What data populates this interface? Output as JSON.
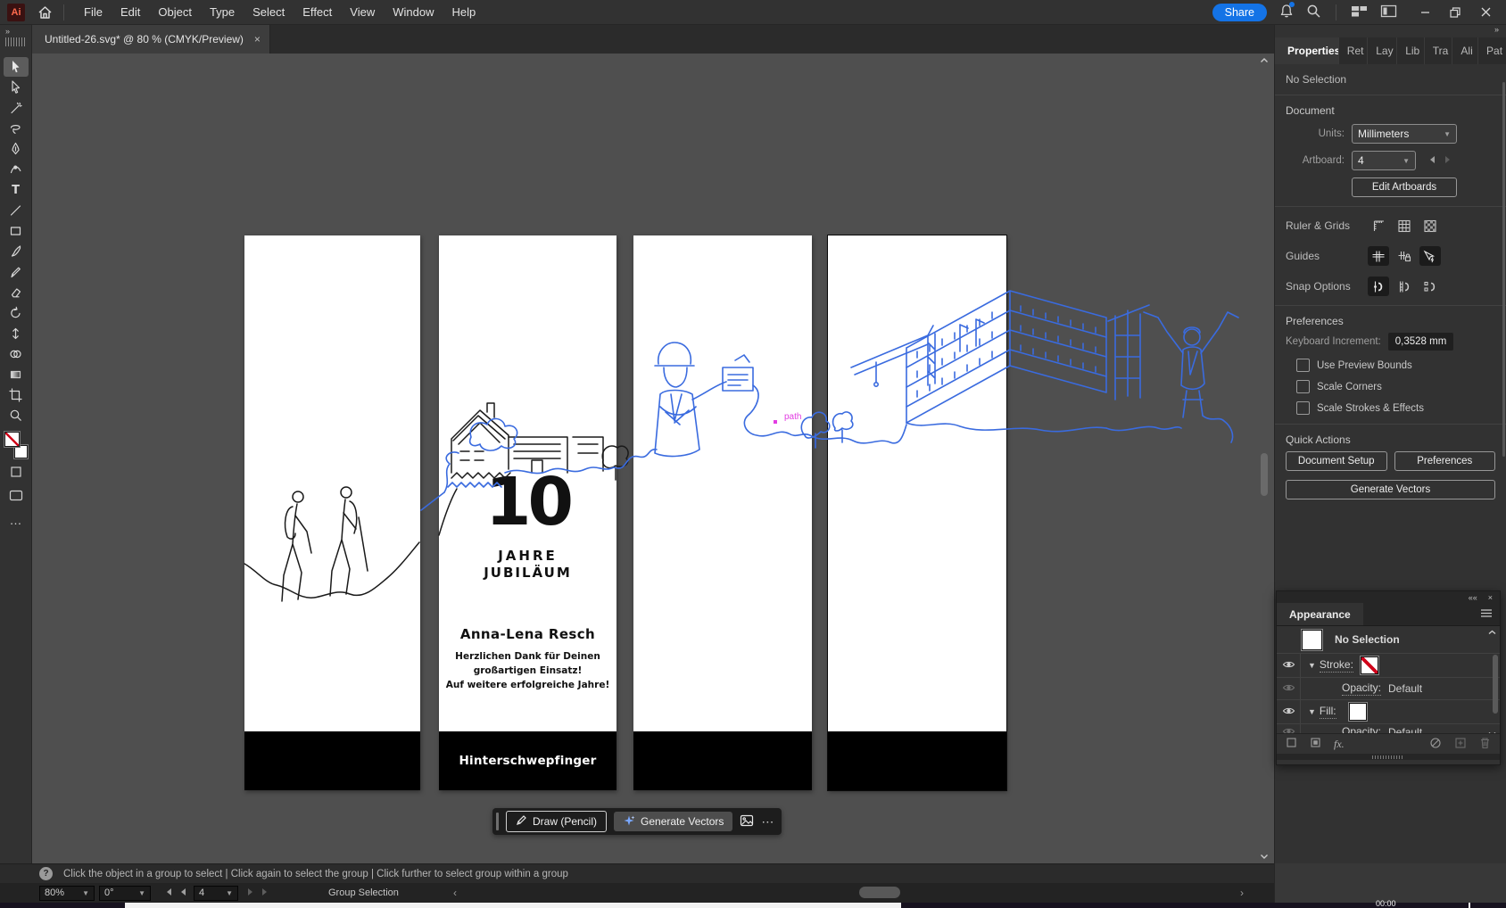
{
  "window": {
    "app_badge": "Ai",
    "share": "Share",
    "timer": "00:00"
  },
  "menubar": {
    "items": [
      "File",
      "Edit",
      "Object",
      "Type",
      "Select",
      "Effect",
      "View",
      "Window",
      "Help"
    ]
  },
  "tab": {
    "title": "Untitled-26.svg* @ 80 % (CMYK/Preview)",
    "close": "×"
  },
  "panel": {
    "tabs": [
      "Properties",
      "Ret",
      "Lay",
      "Lib",
      "Tra",
      "Ali",
      "Pat"
    ],
    "no_selection": "No Selection",
    "document": {
      "title": "Document",
      "units_label": "Units:",
      "units_value": "Millimeters",
      "artboard_label": "Artboard:",
      "artboard_value": "4",
      "edit_artboards": "Edit Artboards"
    },
    "ruler_grids": "Ruler & Grids",
    "guides": "Guides",
    "snap_options": "Snap Options",
    "prefs": {
      "title": "Preferences",
      "keyboard_increment_label": "Keyboard Increment:",
      "keyboard_increment_value": "0,3528 mm",
      "checks": [
        "Use Preview Bounds",
        "Scale Corners",
        "Scale Strokes & Effects"
      ]
    },
    "quick_actions": {
      "title": "Quick Actions",
      "document_setup": "Document Setup",
      "preferences": "Preferences",
      "generate_vectors": "Generate Vectors"
    }
  },
  "appearance": {
    "title": "Appearance",
    "no_selection": "No Selection",
    "stroke_label": "Stroke:",
    "fill_label": "Fill:",
    "opacity_label": "Opacity:",
    "opacity_value": "Default",
    "fx": "fx."
  },
  "artboard2": {
    "big_number": "10",
    "jahre": "JAHRE",
    "jubilaeum": "JUBILÄUM",
    "name": "Anna-Lena Resch",
    "msg1": "Herzlichen Dank für Deinen",
    "msg2": "großartigen Einsatz!",
    "msg3": "Auf weitere erfolgreiche Jahre!",
    "footer": "Hinterschwepfinger"
  },
  "canvas": {
    "path_label": "path"
  },
  "float_toolbar": {
    "draw": "Draw (Pencil)",
    "generate": "Generate Vectors"
  },
  "hint": {
    "icon": "?",
    "text": "Click the object in a group to select   |   Click again to select the group   |   Click further to select group within a group"
  },
  "status": {
    "zoom": "80%",
    "rotation": "0°",
    "artboard": "4",
    "tool": "Group Selection"
  },
  "colors": {
    "accent_blue": "#1473e6",
    "art_blue": "#3a6bdf",
    "art_black": "#1a1a1a",
    "magenta": "#e23de2"
  }
}
